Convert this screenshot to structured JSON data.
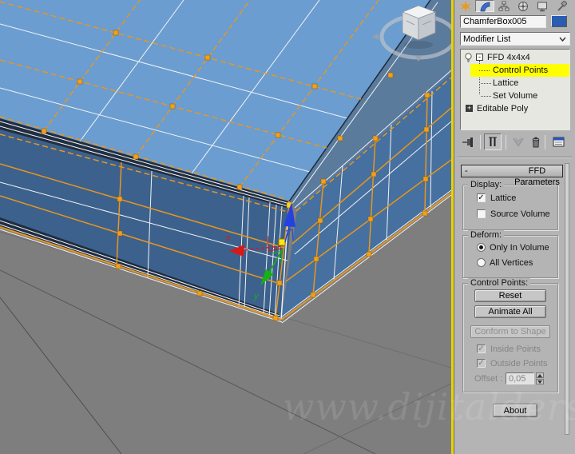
{
  "watermark": "www.dijitalders.com",
  "viewport": {
    "description": "perspective viewport, chamfered box with FFD 4x4x4 lattice, Control Points sub-object active",
    "axis_labels": {
      "x": "x",
      "y": "y"
    },
    "colors": {
      "background": "#7e7e7e",
      "top_face": "#6b9dd1",
      "front_face": "#3c618d",
      "right_face": "#46709f",
      "wireframe": "#f2f2f2",
      "lattice": "#e8961e",
      "selected_point": "#ffe80a",
      "active_border": "#e8d200",
      "gizmo_x": "#d91818",
      "gizmo_y": "#15b115",
      "gizmo_z": "#2442e0"
    }
  },
  "panel": {
    "tabs": [
      {
        "icon": "create-icon"
      },
      {
        "icon": "modify-icon",
        "active": true
      },
      {
        "icon": "hierarchy-icon"
      },
      {
        "icon": "motion-icon"
      },
      {
        "icon": "display-icon"
      },
      {
        "icon": "utilities-icon"
      }
    ],
    "object_name": "ChamferBox005",
    "object_color": "#2a5caf",
    "modifier_list_label": "Modifier List",
    "stack": {
      "modifier": "FFD 4x4x4",
      "sub_items": [
        "Control Points",
        "Lattice",
        "Set Volume"
      ],
      "selected_sub_item": "Control Points",
      "base_object": "Editable Poly"
    },
    "stack_toolbar": [
      "pin-stack-icon",
      "show-end-result-icon",
      "make-unique-icon",
      "remove-modifier-icon",
      "configure-modifier-sets-icon"
    ],
    "rollout": {
      "title": "FFD Parameters",
      "collapse_glyph": "-",
      "display": {
        "label": "Display:",
        "lattice": "Lattice",
        "lattice_checked": true,
        "source_volume": "Source Volume",
        "source_volume_checked": false
      },
      "deform": {
        "label": "Deform:",
        "only_in_volume": "Only In Volume",
        "all_vertices": "All Vertices",
        "selected": "Only In Volume"
      },
      "control_points": {
        "label": "Control Points:",
        "reset": "Reset",
        "animate_all": "Animate All",
        "conform_to_shape": "Conform to Shape",
        "conform_enabled": false,
        "inside_points": "Inside Points",
        "inside_checked": true,
        "inside_enabled": false,
        "outside_points": "Outside Points",
        "outside_checked": true,
        "outside_enabled": false,
        "offset_label": "Offset :",
        "offset_value": "0,05",
        "offset_enabled": false
      },
      "about": "About"
    }
  }
}
